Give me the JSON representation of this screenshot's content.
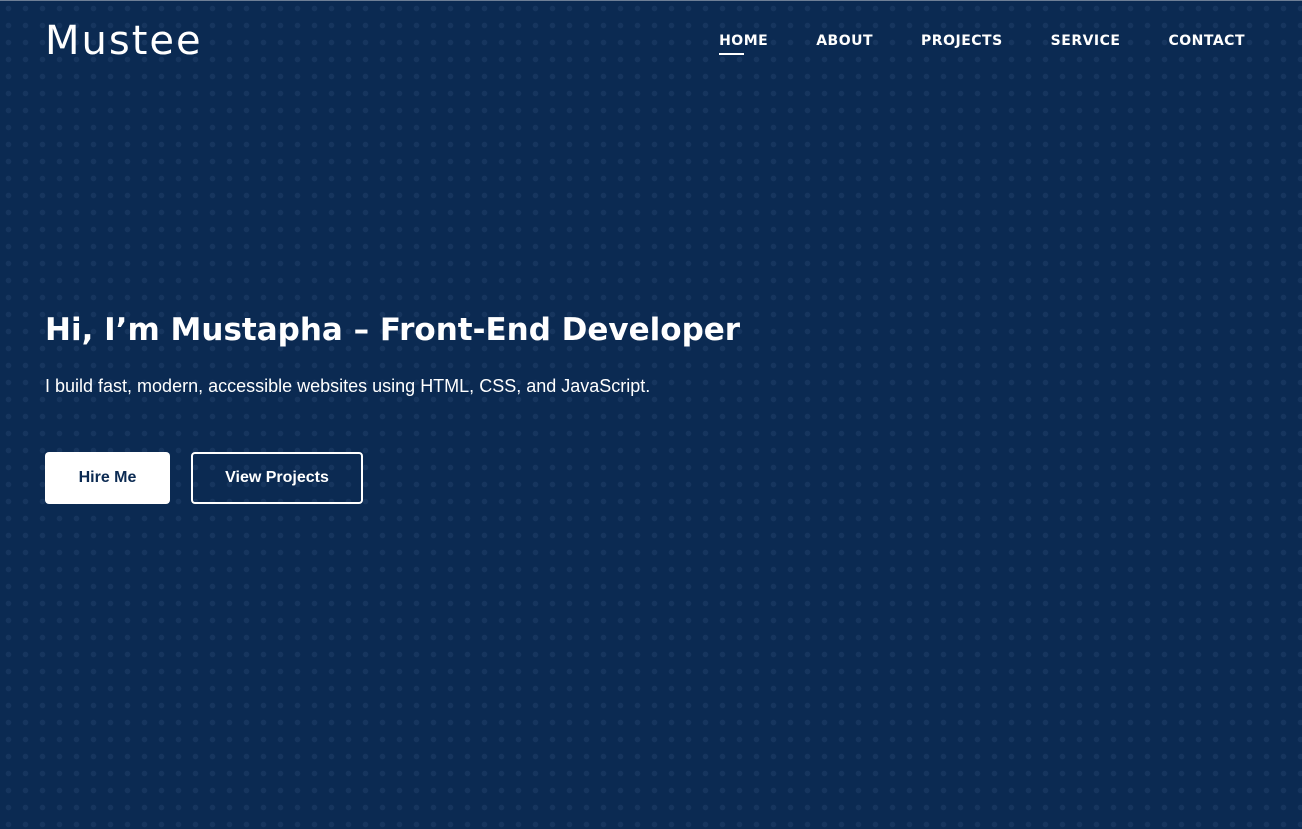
{
  "brand": {
    "logo": "Mustee"
  },
  "nav": {
    "items": [
      {
        "label": "HOME",
        "active": true
      },
      {
        "label": "ABOUT"
      },
      {
        "label": "PROJECTS"
      },
      {
        "label": "SERVICE"
      },
      {
        "label": "CONTACT"
      }
    ]
  },
  "hero": {
    "title": "Hi, I’m Mustapha – Front-End Developer",
    "subtitle": "I build fast, modern, accessible websites using HTML, CSS, and JavaScript.",
    "primary_button": "Hire Me",
    "secondary_button": "View Projects"
  },
  "colors": {
    "background": "#0b2a52",
    "text": "#ffffff"
  }
}
